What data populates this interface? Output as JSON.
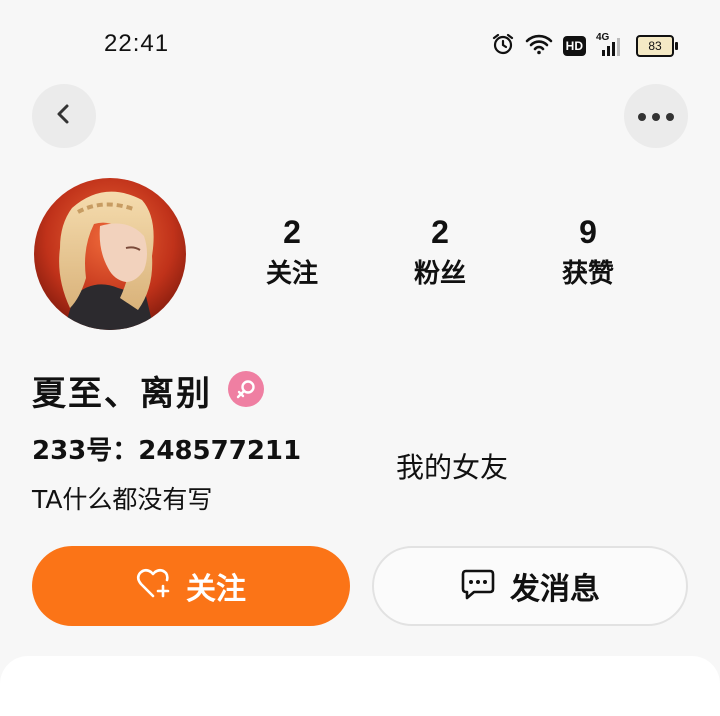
{
  "status_bar": {
    "time": "22:41",
    "battery": "83",
    "network": "4G",
    "hd": "HD"
  },
  "profile": {
    "nickname": "夏至、离别",
    "gender": "female",
    "uid": "233号：248577211",
    "bio": "TA什么都没有写",
    "signature": "我的女友",
    "stats": [
      {
        "value": "2",
        "label": "关注"
      },
      {
        "value": "2",
        "label": "粉丝"
      },
      {
        "value": "9",
        "label": "获赞"
      }
    ]
  },
  "actions": {
    "follow_label": "关注",
    "message_label": "发消息"
  },
  "colors": {
    "accent": "#fb7417",
    "gender_female": "#ef7fa2",
    "background": "#f7f7f7"
  },
  "icons": {
    "back": "chevron-left-icon",
    "more": "more-dots-icon",
    "follow": "heart-plus-icon",
    "message": "chat-bubble-icon",
    "gender": "female-icon"
  }
}
